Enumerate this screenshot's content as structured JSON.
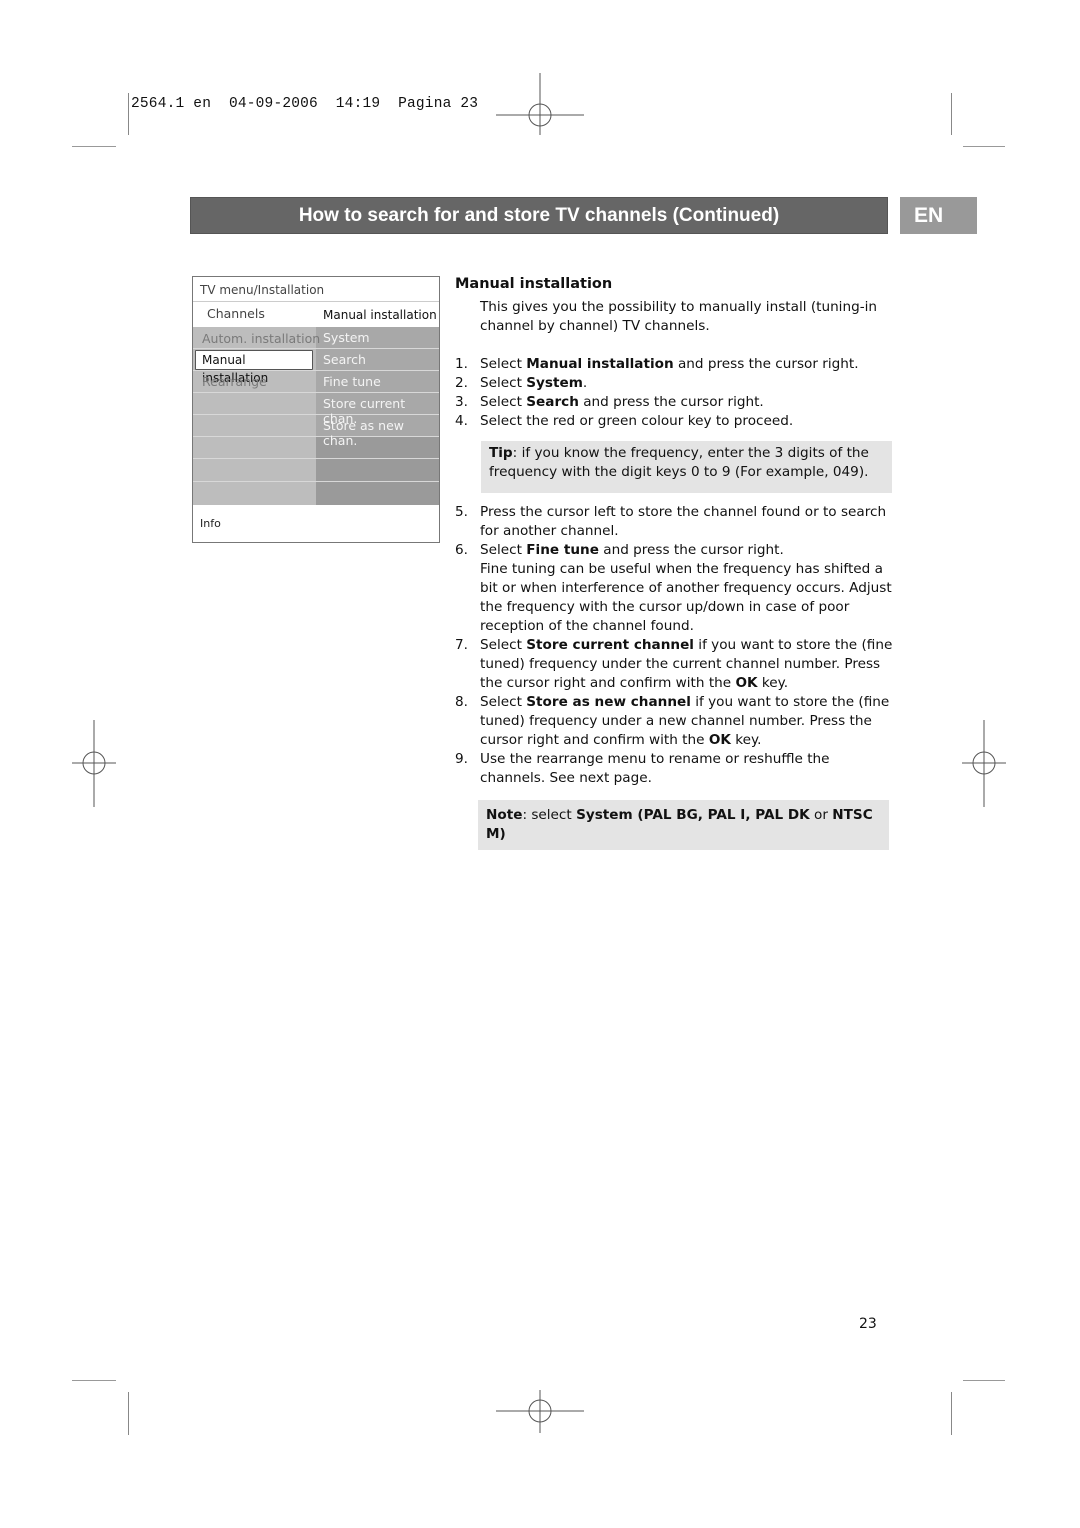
{
  "print_header": {
    "job": "2564.1 en",
    "date": "04-09-2006",
    "time": "14:19",
    "page_label": "Pagina 23"
  },
  "title_bar": {
    "title": "How to search for and store TV channels  (Continued)",
    "language_badge": "EN"
  },
  "tv_menu": {
    "breadcrumb": "TV menu/Installation",
    "left_header": "Channels",
    "right_header": "Manual installation",
    "left_items": [
      {
        "label": "Autom. installation",
        "selected": false
      },
      {
        "label": "Manual installation",
        "selected": true
      },
      {
        "label": "Rearrange",
        "selected": false
      }
    ],
    "right_items": [
      {
        "label": "System"
      },
      {
        "label": "Search"
      },
      {
        "label": "Fine tune"
      },
      {
        "label": "Store current chan."
      },
      {
        "label": "Store as new chan."
      }
    ],
    "info_label": "Info"
  },
  "section": {
    "heading": "Manual installation",
    "intro": "This gives you the possibility to manually install (tuning-in channel by channel) TV channels.",
    "steps_a": [
      {
        "num": "1.",
        "pre": "Select ",
        "bold": "Manual installation",
        "post": " and press the cursor right."
      },
      {
        "num": "2.",
        "pre": "Select ",
        "bold": "System",
        "post": "."
      },
      {
        "num": "3.",
        "pre": "Select ",
        "bold": "Search",
        "post": " and press the cursor right."
      },
      {
        "num": "4.",
        "pre": "Select the red or green colour key to proceed.",
        "bold": "",
        "post": ""
      }
    ],
    "tip": {
      "label": "Tip",
      "text": ": if you know the frequency, enter the 3 digits of the frequency with the digit keys 0 to 9 (For example, 049)."
    },
    "steps_b": [
      {
        "num": "5.",
        "pre": "Press the cursor left to store the channel found or to search for another channel.",
        "bold": "",
        "post": "",
        "extra": "",
        "ok": ""
      },
      {
        "num": "6.",
        "pre": "Select ",
        "bold": "Fine tune",
        "post": " and press the cursor right.",
        "extra": "Fine tuning can be useful when the frequency has shifted a bit or when interference of another frequency occurs. Adjust the frequency with the cursor up/down in case of poor reception of the channel found.",
        "ok": ""
      },
      {
        "num": "7.",
        "pre": "Select ",
        "bold": "Store current channel",
        "post": " if you want to store the (fine tuned) frequency under the current channel number. Press the cursor right and confirm with the ",
        "extra": "",
        "ok": "OK",
        "ok_post": " key."
      },
      {
        "num": "8.",
        "pre": "Select ",
        "bold": "Store as new channel",
        "post": " if you want to store the (fine tuned) frequency under a new channel number. Press the cursor right and confirm with the ",
        "extra": "",
        "ok": "OK",
        "ok_post": " key."
      },
      {
        "num": "9.",
        "pre": "Use the rearrange menu to rename or reshuffle the channels. See next page.",
        "bold": "",
        "post": "",
        "extra": "",
        "ok": ""
      }
    ],
    "note": {
      "label": "Note",
      "t1": ": select ",
      "b1": "System (PAL BG, PAL I, PAL DK",
      "t2": " or ",
      "b2": "NTSC M)"
    }
  },
  "page_number": "23"
}
